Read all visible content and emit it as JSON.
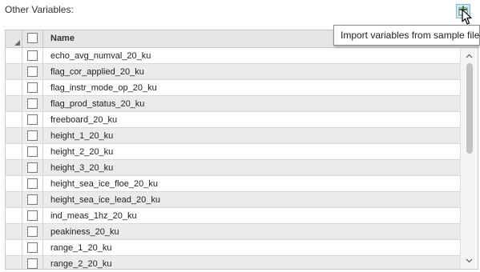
{
  "section": {
    "label": "Other Variables:"
  },
  "import_button": {
    "icon": "import-plus-icon"
  },
  "tooltip": {
    "text": "Import variables from sample file"
  },
  "grid": {
    "column_header": "Name",
    "rows": [
      {
        "name": "echo_avg_numval_20_ku",
        "checked": false
      },
      {
        "name": "flag_cor_applied_20_ku",
        "checked": false
      },
      {
        "name": "flag_instr_mode_op_20_ku",
        "checked": false
      },
      {
        "name": "flag_prod_status_20_ku",
        "checked": false
      },
      {
        "name": "freeboard_20_ku",
        "checked": false
      },
      {
        "name": "height_1_20_ku",
        "checked": false
      },
      {
        "name": "height_2_20_ku",
        "checked": false
      },
      {
        "name": "height_3_20_ku",
        "checked": false
      },
      {
        "name": "height_sea_ice_floe_20_ku",
        "checked": false
      },
      {
        "name": "height_sea_ice_lead_20_ku",
        "checked": false
      },
      {
        "name": "ind_meas_1hz_20_ku",
        "checked": false
      },
      {
        "name": "peakiness_20_ku",
        "checked": false
      },
      {
        "name": "range_1_20_ku",
        "checked": false
      },
      {
        "name": "range_2_20_ku",
        "checked": false
      }
    ]
  },
  "colors": {
    "header_bg": "#e6e6e6",
    "alt_row_bg": "#ebebeb",
    "import_button_bg": "#cde8f7",
    "import_icon": "#2e7d32"
  }
}
